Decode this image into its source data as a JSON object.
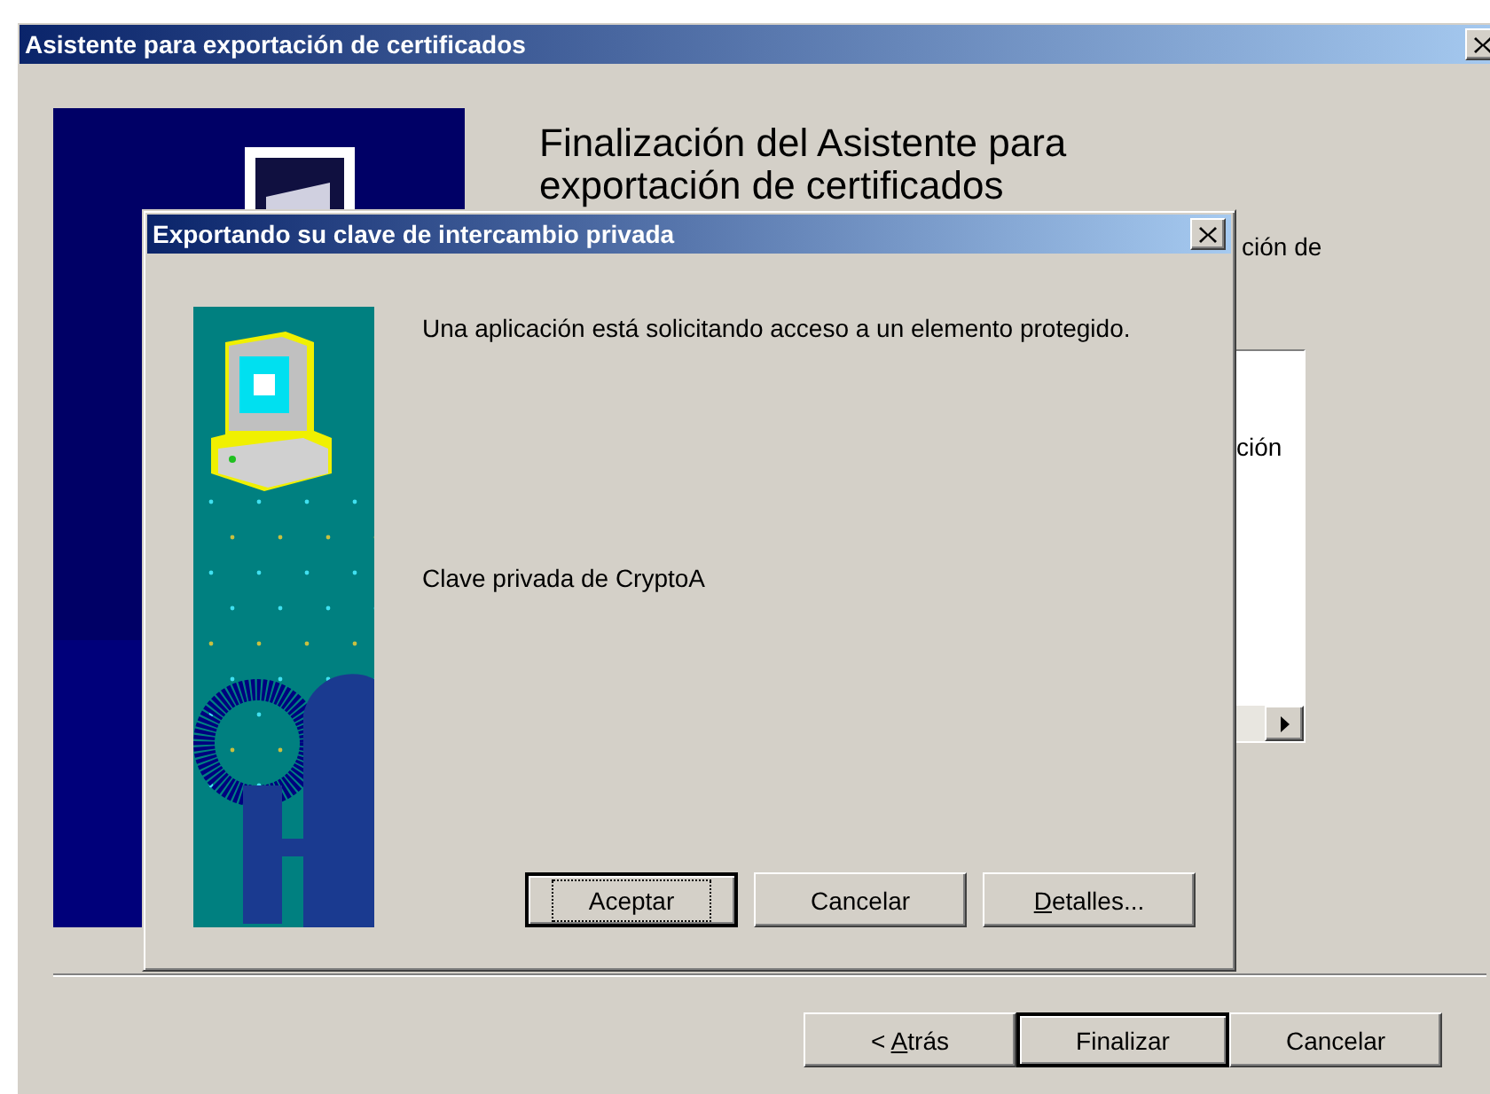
{
  "wizard": {
    "title": "Asistente para exportación de certificados",
    "heading": "Finalización del Asistente para exportación de certificados",
    "fragment_1": "ción de",
    "list_fragment": "ción",
    "buttons": [
      {
        "before": "< ",
        "key": "A",
        "after": "trás",
        "default": false
      },
      {
        "after": "Finalizar",
        "default": true
      },
      {
        "after": "Cancelar",
        "default": false
      }
    ]
  },
  "dialog": {
    "title": "Exportando su clave de intercambio privada",
    "message": "Una aplicación está solicitando acceso a un elemento protegido.",
    "item": "Clave privada de CryptoA",
    "buttons": [
      {
        "after": "Aceptar",
        "default": true
      },
      {
        "after": "Cancelar",
        "default": false
      },
      {
        "key": "D",
        "after": "etalles...",
        "default": false
      }
    ]
  }
}
